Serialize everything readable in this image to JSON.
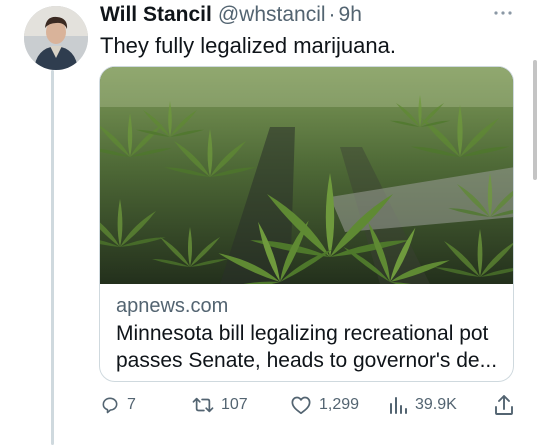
{
  "tweet": {
    "author": {
      "display_name": "Will Stancil",
      "handle": "@whstancil",
      "time": "9h"
    },
    "text": "They fully legalized marijuana.",
    "card": {
      "domain": "apnews.com",
      "title": "Minnesota bill legalizing recreational pot passes Senate, heads to governor's de..."
    },
    "actions": {
      "replies": "7",
      "retweets": "107",
      "likes": "1,299",
      "views": "39.9K"
    },
    "separator": "·"
  },
  "icons": {
    "more": "more-dots-icon",
    "reply": "reply-icon",
    "retweet": "retweet-icon",
    "like": "heart-icon",
    "views": "views-bar-icon",
    "share": "share-icon"
  },
  "colors": {
    "text_primary": "#0f1419",
    "text_secondary": "#536471",
    "border": "#cfd9de"
  }
}
